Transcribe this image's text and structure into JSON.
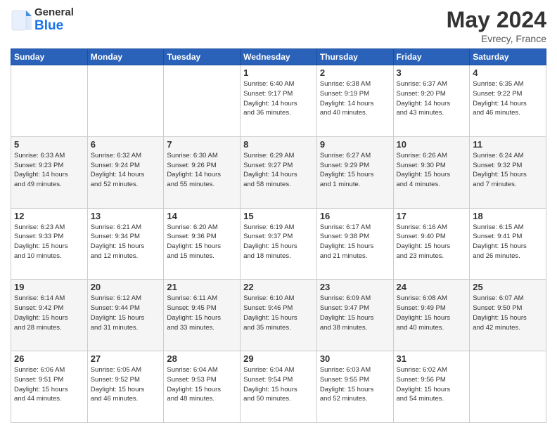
{
  "header": {
    "logo_general": "General",
    "logo_blue": "Blue",
    "month": "May 2024",
    "location": "Evrecy, France"
  },
  "days_of_week": [
    "Sunday",
    "Monday",
    "Tuesday",
    "Wednesday",
    "Thursday",
    "Friday",
    "Saturday"
  ],
  "weeks": [
    [
      {
        "day": "",
        "info": ""
      },
      {
        "day": "",
        "info": ""
      },
      {
        "day": "",
        "info": ""
      },
      {
        "day": "1",
        "info": "Sunrise: 6:40 AM\nSunset: 9:17 PM\nDaylight: 14 hours\nand 36 minutes."
      },
      {
        "day": "2",
        "info": "Sunrise: 6:38 AM\nSunset: 9:19 PM\nDaylight: 14 hours\nand 40 minutes."
      },
      {
        "day": "3",
        "info": "Sunrise: 6:37 AM\nSunset: 9:20 PM\nDaylight: 14 hours\nand 43 minutes."
      },
      {
        "day": "4",
        "info": "Sunrise: 6:35 AM\nSunset: 9:22 PM\nDaylight: 14 hours\nand 46 minutes."
      }
    ],
    [
      {
        "day": "5",
        "info": "Sunrise: 6:33 AM\nSunset: 9:23 PM\nDaylight: 14 hours\nand 49 minutes."
      },
      {
        "day": "6",
        "info": "Sunrise: 6:32 AM\nSunset: 9:24 PM\nDaylight: 14 hours\nand 52 minutes."
      },
      {
        "day": "7",
        "info": "Sunrise: 6:30 AM\nSunset: 9:26 PM\nDaylight: 14 hours\nand 55 minutes."
      },
      {
        "day": "8",
        "info": "Sunrise: 6:29 AM\nSunset: 9:27 PM\nDaylight: 14 hours\nand 58 minutes."
      },
      {
        "day": "9",
        "info": "Sunrise: 6:27 AM\nSunset: 9:29 PM\nDaylight: 15 hours\nand 1 minute."
      },
      {
        "day": "10",
        "info": "Sunrise: 6:26 AM\nSunset: 9:30 PM\nDaylight: 15 hours\nand 4 minutes."
      },
      {
        "day": "11",
        "info": "Sunrise: 6:24 AM\nSunset: 9:32 PM\nDaylight: 15 hours\nand 7 minutes."
      }
    ],
    [
      {
        "day": "12",
        "info": "Sunrise: 6:23 AM\nSunset: 9:33 PM\nDaylight: 15 hours\nand 10 minutes."
      },
      {
        "day": "13",
        "info": "Sunrise: 6:21 AM\nSunset: 9:34 PM\nDaylight: 15 hours\nand 12 minutes."
      },
      {
        "day": "14",
        "info": "Sunrise: 6:20 AM\nSunset: 9:36 PM\nDaylight: 15 hours\nand 15 minutes."
      },
      {
        "day": "15",
        "info": "Sunrise: 6:19 AM\nSunset: 9:37 PM\nDaylight: 15 hours\nand 18 minutes."
      },
      {
        "day": "16",
        "info": "Sunrise: 6:17 AM\nSunset: 9:38 PM\nDaylight: 15 hours\nand 21 minutes."
      },
      {
        "day": "17",
        "info": "Sunrise: 6:16 AM\nSunset: 9:40 PM\nDaylight: 15 hours\nand 23 minutes."
      },
      {
        "day": "18",
        "info": "Sunrise: 6:15 AM\nSunset: 9:41 PM\nDaylight: 15 hours\nand 26 minutes."
      }
    ],
    [
      {
        "day": "19",
        "info": "Sunrise: 6:14 AM\nSunset: 9:42 PM\nDaylight: 15 hours\nand 28 minutes."
      },
      {
        "day": "20",
        "info": "Sunrise: 6:12 AM\nSunset: 9:44 PM\nDaylight: 15 hours\nand 31 minutes."
      },
      {
        "day": "21",
        "info": "Sunrise: 6:11 AM\nSunset: 9:45 PM\nDaylight: 15 hours\nand 33 minutes."
      },
      {
        "day": "22",
        "info": "Sunrise: 6:10 AM\nSunset: 9:46 PM\nDaylight: 15 hours\nand 35 minutes."
      },
      {
        "day": "23",
        "info": "Sunrise: 6:09 AM\nSunset: 9:47 PM\nDaylight: 15 hours\nand 38 minutes."
      },
      {
        "day": "24",
        "info": "Sunrise: 6:08 AM\nSunset: 9:49 PM\nDaylight: 15 hours\nand 40 minutes."
      },
      {
        "day": "25",
        "info": "Sunrise: 6:07 AM\nSunset: 9:50 PM\nDaylight: 15 hours\nand 42 minutes."
      }
    ],
    [
      {
        "day": "26",
        "info": "Sunrise: 6:06 AM\nSunset: 9:51 PM\nDaylight: 15 hours\nand 44 minutes."
      },
      {
        "day": "27",
        "info": "Sunrise: 6:05 AM\nSunset: 9:52 PM\nDaylight: 15 hours\nand 46 minutes."
      },
      {
        "day": "28",
        "info": "Sunrise: 6:04 AM\nSunset: 9:53 PM\nDaylight: 15 hours\nand 48 minutes."
      },
      {
        "day": "29",
        "info": "Sunrise: 6:04 AM\nSunset: 9:54 PM\nDaylight: 15 hours\nand 50 minutes."
      },
      {
        "day": "30",
        "info": "Sunrise: 6:03 AM\nSunset: 9:55 PM\nDaylight: 15 hours\nand 52 minutes."
      },
      {
        "day": "31",
        "info": "Sunrise: 6:02 AM\nSunset: 9:56 PM\nDaylight: 15 hours\nand 54 minutes."
      },
      {
        "day": "",
        "info": ""
      }
    ]
  ]
}
